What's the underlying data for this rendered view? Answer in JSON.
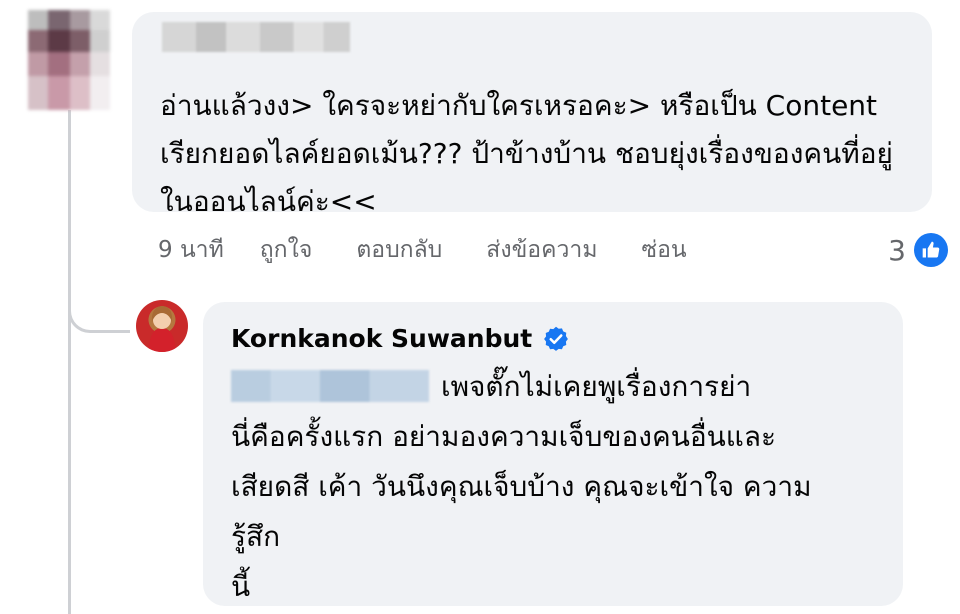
{
  "comment": {
    "text": "อ่านแล้วงง> ใครจะหย่ากับใครเหรอคะ> หรือเป็น Content เรียกยอดไลค์ยอดเม้น??? ป้าข้างบ้าน ชอบยุ่งเรื่องของคนที่อยู่ในออนไลน์ค่ะ<<",
    "time": "9 นาที",
    "actions": [
      "ถูกใจ",
      "ตอบกลับ",
      "ส่งข้อความ",
      "ซ่อน"
    ],
    "reaction_count": "3",
    "reaction_icon": "like-icon"
  },
  "reply": {
    "author": "Kornkanok Suwanbut",
    "verified_icon": "verified-badge-icon",
    "text": "เพจตั๊กไม่เคยพูเรื่องการย่า\nนี่คือครั้งแรก อย่ามองความเจ็บของคนอื่นและ\nเสียดสี เค้า วันนึงคุณเจ็บบ้าง คุณจะเข้าใจ ความ\nรู้สึก\nนี้"
  },
  "colors": {
    "bubble": "#f0f2f5",
    "meta_text": "#65676b",
    "facebook_blue": "#1877f2",
    "thread_line": "#ced0d4"
  }
}
